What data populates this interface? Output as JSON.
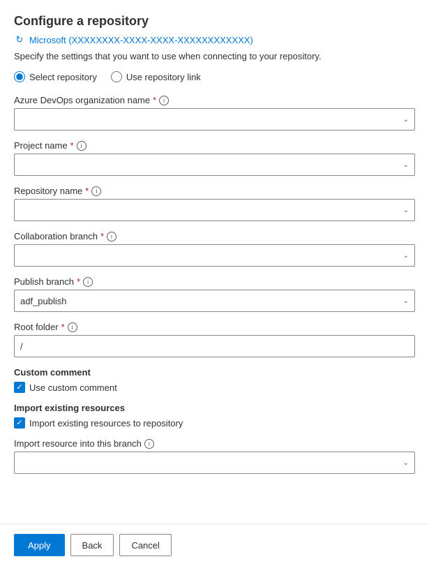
{
  "page": {
    "title": "Configure a repository",
    "account": "Microsoft (XXXXXXXX-XXXX-XXXX-XXXXXXXXXXXX)",
    "subtitle": "Specify the settings that you want to use when connecting to your repository."
  },
  "radio_group": {
    "option1_label": "Select repository",
    "option2_label": "Use repository link",
    "selected": "select"
  },
  "fields": {
    "azure_devops_label": "Azure DevOps organization name",
    "project_label": "Project name",
    "repository_label": "Repository name",
    "collaboration_label": "Collaboration branch",
    "publish_label": "Publish branch",
    "publish_value": "adf_publish",
    "root_label": "Root folder",
    "root_value": "/",
    "import_branch_label": "Import resource into this branch"
  },
  "custom_comment": {
    "section_label": "Custom comment",
    "checkbox_label": "Use custom comment"
  },
  "import_resources": {
    "section_label": "Import existing resources",
    "checkbox_label": "Import existing resources to repository"
  },
  "footer": {
    "apply_label": "Apply",
    "back_label": "Back",
    "cancel_label": "Cancel"
  },
  "icons": {
    "info": "i",
    "chevron": "⌄",
    "check": "✓",
    "refresh": "↻"
  }
}
